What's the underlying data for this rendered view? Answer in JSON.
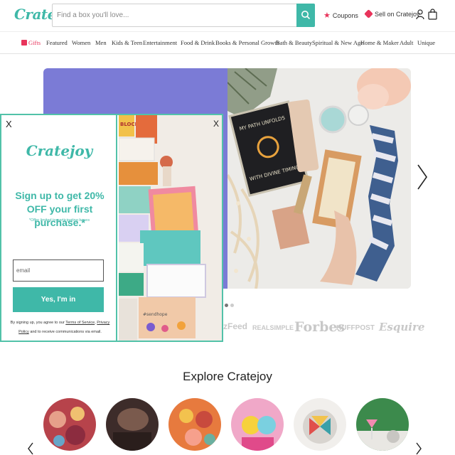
{
  "header": {
    "logo": "Cratejoy",
    "search_placeholder": "Find a box you'll love...",
    "coupons_label": "Coupons",
    "sell_label": "Sell on Cratejoy",
    "icons": [
      "search-icon",
      "star-icon",
      "tag-icon",
      "user-icon",
      "bag-icon"
    ]
  },
  "nav": {
    "items": [
      "Gifts",
      "Featured",
      "Women",
      "Men",
      "Kids & Teen",
      "Entertainment",
      "Food & Drink",
      "Books & Personal Growth",
      "Bath & Beauty",
      "Spiritual & New Age",
      "Home & Maker",
      "Adult",
      "Unique"
    ]
  },
  "hero": {
    "card_text": [
      "MY PATH UNFOLDS",
      "WITH DIVINE TIMING"
    ],
    "slides": 2,
    "active_slide": 1
  },
  "press": [
    "zFeed",
    "REALSIMPLE",
    "Forbes",
    "HUFFPOST",
    "Esquire"
  ],
  "explore": {
    "title": "Explore Cratejoy"
  },
  "modal": {
    "close_label": "X",
    "logo": "Cratejoy",
    "headline": "Sign up to get 20% OFF your first purchase.*",
    "fine_print": "*Offer limited to participating boxes",
    "email_placeholder": "email",
    "submit_label": "Yes, I'm in",
    "legal_prefix": "By signing up, you agree to our",
    "terms_link": "Terms of Service",
    "legal_mid": ",",
    "privacy_link_1": "Privacy",
    "privacy_link_2": "Policy",
    "legal_suffix": "and to receive communications via email.",
    "photo_text": [
      "BLOCK",
      "#sendhope"
    ]
  },
  "colors": {
    "brand_teal": "#3fb8a8",
    "modal_border": "#52c2a9",
    "accent_pink": "#e8345b",
    "hero_purple": "#7b7bd6"
  }
}
